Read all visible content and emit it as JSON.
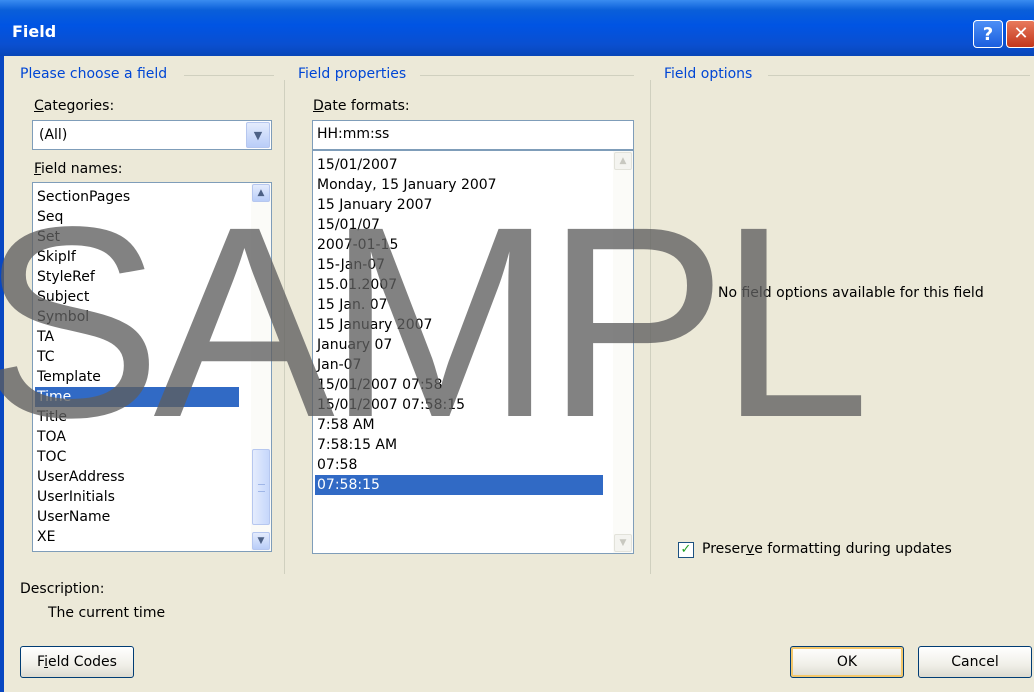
{
  "window": {
    "title": "Field",
    "help_glyph": "?",
    "close_glyph": "✕"
  },
  "groups": {
    "choose": "Please choose a field",
    "properties": "Field properties",
    "options": "Field options"
  },
  "categories": {
    "label": "Categories:",
    "value": "(All)"
  },
  "field_names": {
    "label": "Field names:",
    "items": [
      "SectionPages",
      "Seq",
      "Set",
      "SkipIf",
      "StyleRef",
      "Subject",
      "Symbol",
      "TA",
      "TC",
      "Template",
      "Time",
      "Title",
      "TOA",
      "TOC",
      "UserAddress",
      "UserInitials",
      "UserName",
      "XE"
    ],
    "selected": "Time"
  },
  "date_formats": {
    "label": "Date formats:",
    "value": "HH:mm:ss",
    "items": [
      "15/01/2007",
      "Monday, 15 January 2007",
      "15 January 2007",
      "15/01/07",
      "2007-01-15",
      "15-Jan-07",
      "15.01.2007",
      "15 Jan. 07",
      "15 January 2007",
      "January 07",
      "Jan-07",
      "15/01/2007 07:58",
      "15/01/2007 07:58:15",
      "7:58 AM",
      "7:58:15 AM",
      "07:58",
      "07:58:15"
    ],
    "selected": "07:58:15"
  },
  "options": {
    "empty_message": "No field options available for this field",
    "preserve_label": "Preserve formatting during updates",
    "preserve_checked": true
  },
  "description": {
    "label": "Description:",
    "text": "The current time"
  },
  "buttons": {
    "field_codes": "Field Codes",
    "ok": "OK",
    "cancel": "Cancel"
  },
  "watermark": "SAMPL",
  "colors": {
    "title_bar": "#0054e3",
    "group_header": "#0046d5",
    "selection": "#316ac5",
    "dialog_bg": "#ece9d8"
  }
}
